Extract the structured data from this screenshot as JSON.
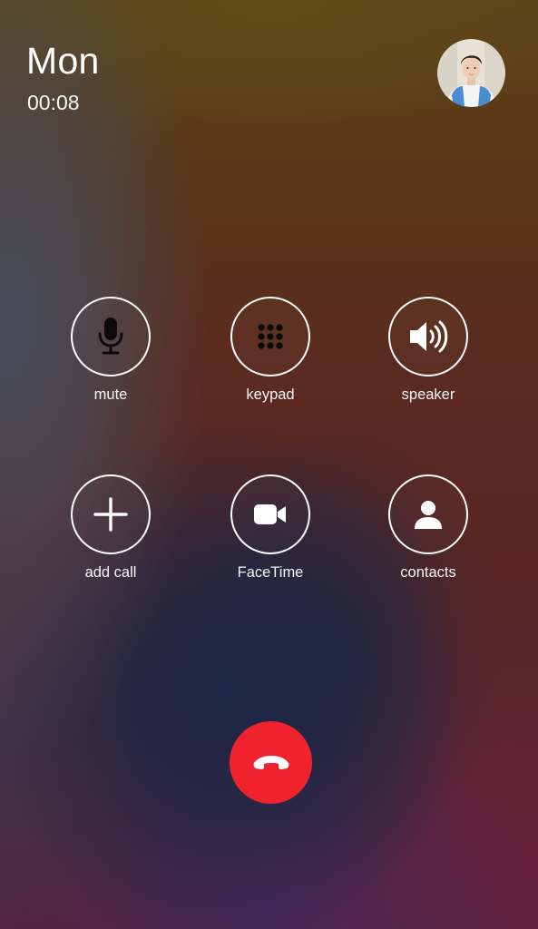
{
  "call": {
    "caller_name": "Mon",
    "duration": "00:08"
  },
  "controls": [
    {
      "label": "mute",
      "icon": "microphone-icon"
    },
    {
      "label": "keypad",
      "icon": "keypad-icon"
    },
    {
      "label": "speaker",
      "icon": "speaker-icon"
    },
    {
      "label": "add call",
      "icon": "plus-icon"
    },
    {
      "label": "FaceTime",
      "icon": "video-camera-icon"
    },
    {
      "label": "contacts",
      "icon": "person-icon"
    }
  ],
  "end_call": {
    "icon": "phone-hangup-icon",
    "color": "#f0222e"
  },
  "colors": {
    "text": "#ffffff",
    "control_ring": "#ffffff",
    "end_call": "#f0222e"
  }
}
